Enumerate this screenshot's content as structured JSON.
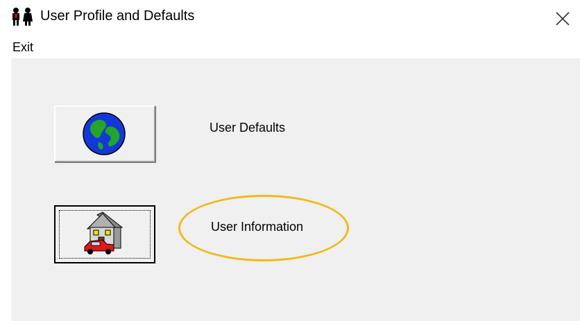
{
  "window": {
    "title": "User Profile and Defaults",
    "app_icon": "people-icon",
    "close_icon": "close-icon"
  },
  "menu": {
    "items": [
      {
        "label": "Exit"
      }
    ]
  },
  "buttons": [
    {
      "label": "User Defaults",
      "icon": "globe-icon"
    },
    {
      "label": "User Information",
      "icon": "house-car-icon",
      "focused": true
    }
  ],
  "annotation": {
    "color": "#f2b91a",
    "target": "User Information"
  }
}
